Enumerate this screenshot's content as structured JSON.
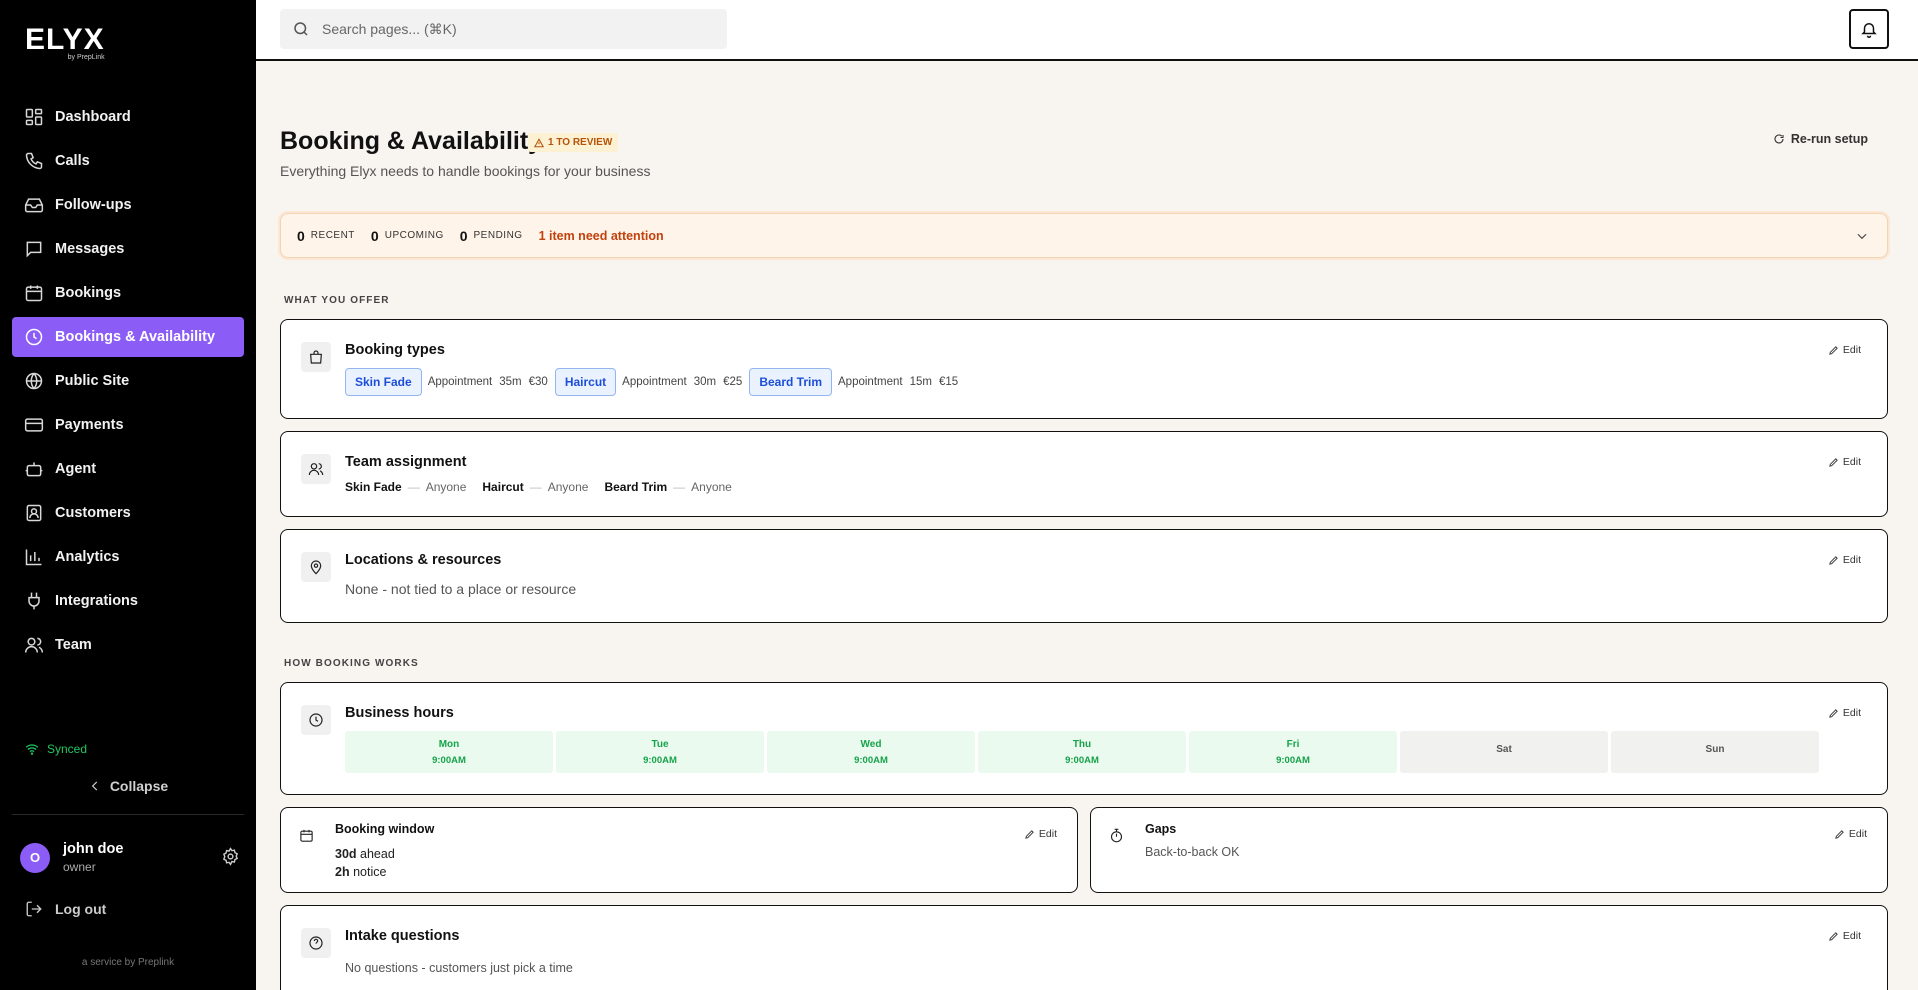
{
  "brand": {
    "name": "ELYX",
    "sub": "by PrepLink"
  },
  "nav": {
    "items": [
      {
        "label": "Dashboard",
        "icon": "dashboard-icon"
      },
      {
        "label": "Calls",
        "icon": "phone-icon"
      },
      {
        "label": "Follow-ups",
        "icon": "inbox-icon"
      },
      {
        "label": "Messages",
        "icon": "message-icon"
      },
      {
        "label": "Bookings",
        "icon": "calendar-icon"
      },
      {
        "label": "Bookings & Availability",
        "icon": "clock-icon",
        "active": true
      },
      {
        "label": "Public Site",
        "icon": "globe-icon"
      },
      {
        "label": "Payments",
        "icon": "card-icon"
      },
      {
        "label": "Agent",
        "icon": "bot-icon"
      },
      {
        "label": "Customers",
        "icon": "contact-icon"
      },
      {
        "label": "Analytics",
        "icon": "chart-icon"
      },
      {
        "label": "Integrations",
        "icon": "plug-icon"
      },
      {
        "label": "Team",
        "icon": "users-icon"
      }
    ]
  },
  "sidebar": {
    "synced": "Synced",
    "collapse": "Collapse",
    "user": {
      "initial": "O",
      "name": "john doe",
      "role": "owner"
    },
    "logout": "Log out",
    "service": "a service by Preplink"
  },
  "topbar": {
    "search_placeholder": "Search pages... (⌘K)"
  },
  "page": {
    "title": "Booking & Availability",
    "badge": "1 TO REVIEW",
    "subtitle": "Everything Elyx needs to handle bookings for your business",
    "rerun": "Re-run setup"
  },
  "summary": {
    "recent": {
      "count": "0",
      "label": "RECENT"
    },
    "upcoming": {
      "count": "0",
      "label": "UPCOMING"
    },
    "pending": {
      "count": "0",
      "label": "PENDING"
    },
    "attention": "1 item need attention"
  },
  "sections": {
    "offer": "WHAT YOU OFFER",
    "how": "HOW BOOKING WORKS"
  },
  "edit_label": "Edit",
  "booking_types": {
    "title": "Booking types",
    "items": [
      {
        "name": "Skin Fade",
        "kind": "Appointment",
        "duration": "35m",
        "price": "€30"
      },
      {
        "name": "Haircut",
        "kind": "Appointment",
        "duration": "30m",
        "price": "€25"
      },
      {
        "name": "Beard Trim",
        "kind": "Appointment",
        "duration": "15m",
        "price": "€15"
      }
    ]
  },
  "team": {
    "title": "Team assignment",
    "dash": "—",
    "items": [
      {
        "service": "Skin Fade",
        "who": "Anyone"
      },
      {
        "service": "Haircut",
        "who": "Anyone"
      },
      {
        "service": "Beard Trim",
        "who": "Anyone"
      }
    ]
  },
  "locations": {
    "title": "Locations & resources",
    "text": "None - not tied to a place or resource"
  },
  "hours": {
    "title": "Business hours",
    "days": [
      {
        "day": "Mon",
        "time": "9:00AM",
        "open": true
      },
      {
        "day": "Tue",
        "time": "9:00AM",
        "open": true
      },
      {
        "day": "Wed",
        "time": "9:00AM",
        "open": true
      },
      {
        "day": "Thu",
        "time": "9:00AM",
        "open": true
      },
      {
        "day": "Fri",
        "time": "9:00AM",
        "open": true
      },
      {
        "day": "Sat",
        "time": "",
        "open": false
      },
      {
        "day": "Sun",
        "time": "",
        "open": false
      }
    ]
  },
  "booking_window": {
    "title": "Booking window",
    "ahead_value": "30d",
    "ahead_label": " ahead",
    "notice_value": "2h",
    "notice_label": " notice"
  },
  "gaps": {
    "title": "Gaps",
    "text": "Back-to-back OK"
  },
  "intake": {
    "title": "Intake questions",
    "text": "No questions - customers just pick a time"
  }
}
